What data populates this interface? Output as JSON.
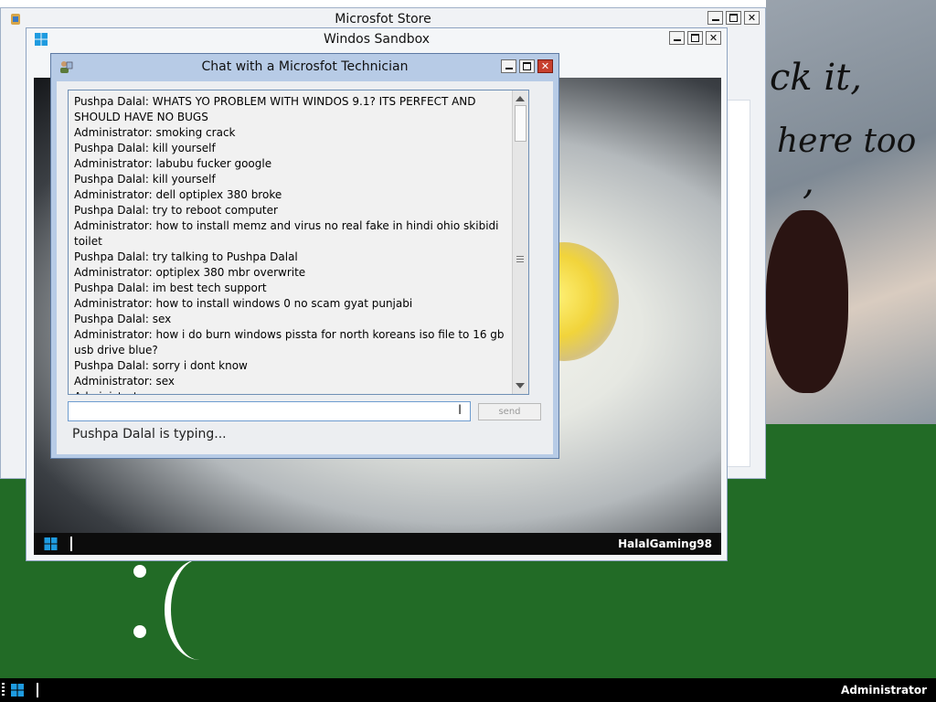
{
  "store_window": {
    "title": "Microsfot Store"
  },
  "sandbox_window": {
    "title": "Windos Sandbox",
    "taskbar_user": "HalalGaming98"
  },
  "chat_window": {
    "title": "Chat with a Microsfot Technician",
    "messages": [
      "Pushpa Dalal: WHATS YO PROBLEM WITH WINDOS 9.1? ITS PERFECT AND SHOULD HAVE NO BUGS",
      "Administrator: smoking crack",
      "Pushpa Dalal: kill yourself",
      "Administrator: labubu fucker google",
      "Pushpa Dalal: kill yourself",
      "Administrator: dell optiplex 380 broke",
      "Pushpa Dalal: try to reboot computer",
      "Administrator: how to install memz and virus no real fake in hindi ohio skibidi toilet",
      "Pushpa Dalal: try talking to Pushpa Dalal",
      "Administrator: optiplex 380 mbr overwrite",
      "Pushpa Dalal: im best tech support",
      "Administrator: how to install windows 0 no scam gyat punjabi",
      "Pushpa Dalal: sex",
      "Administrator: how i do burn windows pissta for north koreans iso file to 16 gb usb drive blue?",
      "Pushpa Dalal: sorry i dont know",
      "Administrator: sex",
      "Administrator: sex"
    ],
    "input_value": "",
    "send_label": "send",
    "status": "Pushpa Dalal is typing..."
  },
  "desktop_art": {
    "lines": [
      "ck it,",
      "here too",
      ","
    ]
  },
  "taskbar": {
    "user": "Administrator"
  },
  "colors": {
    "desktop_green": "#226b26",
    "chat_frame": "#b7cbe6",
    "close_red": "#c7402e"
  },
  "icons": [
    "store-app-icon",
    "sandbox-app-icon",
    "technician-app-icon",
    "windows-start-icon",
    "scroll-up-icon",
    "scroll-down-icon",
    "text-cursor-icon"
  ]
}
